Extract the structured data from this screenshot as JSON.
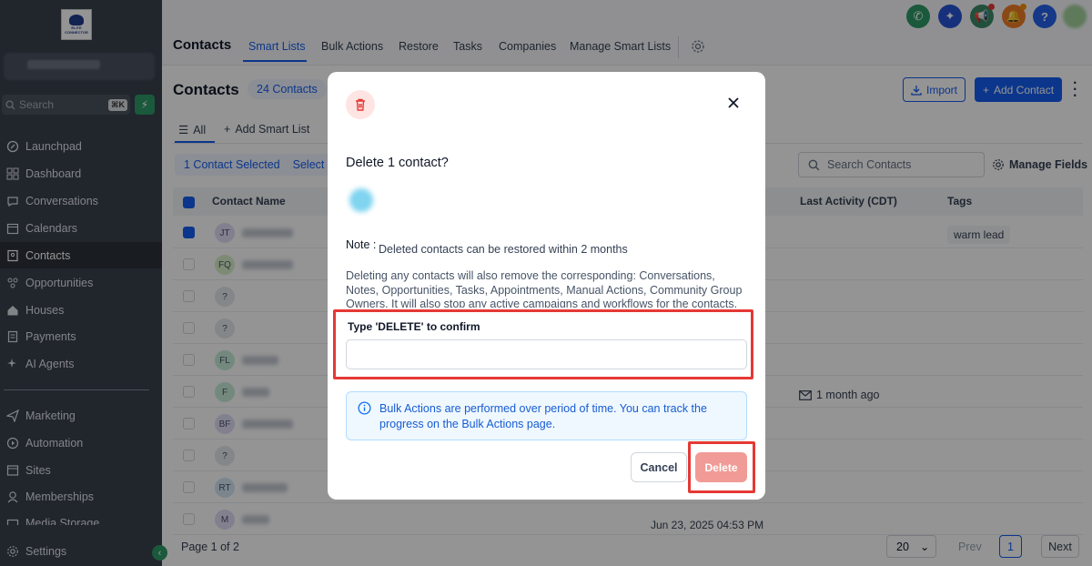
{
  "sidebar": {
    "logo_text": "ELITE CONNECTOR",
    "search_placeholder": "Search",
    "search_shortcut": "⌘K",
    "items": [
      {
        "label": "Launchpad",
        "icon": "rocket-icon"
      },
      {
        "label": "Dashboard",
        "icon": "grid-icon"
      },
      {
        "label": "Conversations",
        "icon": "chat-icon"
      },
      {
        "label": "Calendars",
        "icon": "calendar-icon"
      },
      {
        "label": "Contacts",
        "icon": "contact-book-icon",
        "active": true
      },
      {
        "label": "Opportunities",
        "icon": "funnel-icon"
      },
      {
        "label": "Houses",
        "icon": "house-icon"
      },
      {
        "label": "Payments",
        "icon": "receipt-icon"
      },
      {
        "label": "AI Agents",
        "icon": "sparkle-icon"
      }
    ],
    "items2": [
      {
        "label": "Marketing",
        "icon": "send-icon"
      },
      {
        "label": "Automation",
        "icon": "automation-icon"
      },
      {
        "label": "Sites",
        "icon": "globe-icon"
      },
      {
        "label": "Memberships",
        "icon": "membership-icon"
      },
      {
        "label": "Media Storage",
        "icon": "media-icon"
      }
    ],
    "settings_label": "Settings"
  },
  "header": {
    "title": "Contacts",
    "tabs": [
      "Smart Lists",
      "Bulk Actions",
      "Restore",
      "Tasks",
      "Companies",
      "Manage Smart Lists"
    ],
    "active_tab": "Smart Lists"
  },
  "page": {
    "title": "Contacts",
    "count": "24 Contacts",
    "import_label": "Import",
    "add_contact_label": "Add Contact",
    "list_all": "All",
    "add_smart_list": "Add Smart List",
    "selected_text": "1 Contact Selected",
    "select_all": "Select",
    "search_placeholder": "Search Contacts",
    "manage_fields": "Manage Fields"
  },
  "table": {
    "columns": [
      "Contact Name",
      "Last Activity (CDT)",
      "Tags"
    ],
    "rows": [
      {
        "initials": "JT",
        "checked": true,
        "tag": "warm lead"
      },
      {
        "initials": "FQ"
      },
      {
        "initials": "?"
      },
      {
        "initials": "?"
      },
      {
        "initials": "FL"
      },
      {
        "initials": "F",
        "activity": "1 month ago"
      },
      {
        "initials": "BF"
      },
      {
        "initials": "?"
      },
      {
        "initials": "RT"
      },
      {
        "initials": "M",
        "date": "Jun 23, 2025 04:53 PM"
      }
    ]
  },
  "pagination": {
    "page_text": "Page 1 of 2",
    "per_page": "20",
    "prev": "Prev",
    "current": "1",
    "next": "Next"
  },
  "modal": {
    "title": "Delete 1 contact?",
    "note_label": "Note :",
    "note_text": "Deleted contacts can be restored within 2 months",
    "warning": "Deleting any contacts will also remove the corresponding: Conversations, Notes, Opportunities, Tasks, Appointments, Manual Actions, Community Group Owners. It will also stop any active campaigns and workflows for the contacts.",
    "confirm_label": "Type 'DELETE' to confirm",
    "confirm_value": "",
    "info_text": "Bulk Actions are performed over period of time. You can track the progress on the Bulk Actions page.",
    "cancel_label": "Cancel",
    "delete_label": "Delete"
  },
  "colors": {
    "accent": "#155eef",
    "danger": "#e53935",
    "sidebar_bg": "#3a414d",
    "success": "#2e9a68"
  }
}
